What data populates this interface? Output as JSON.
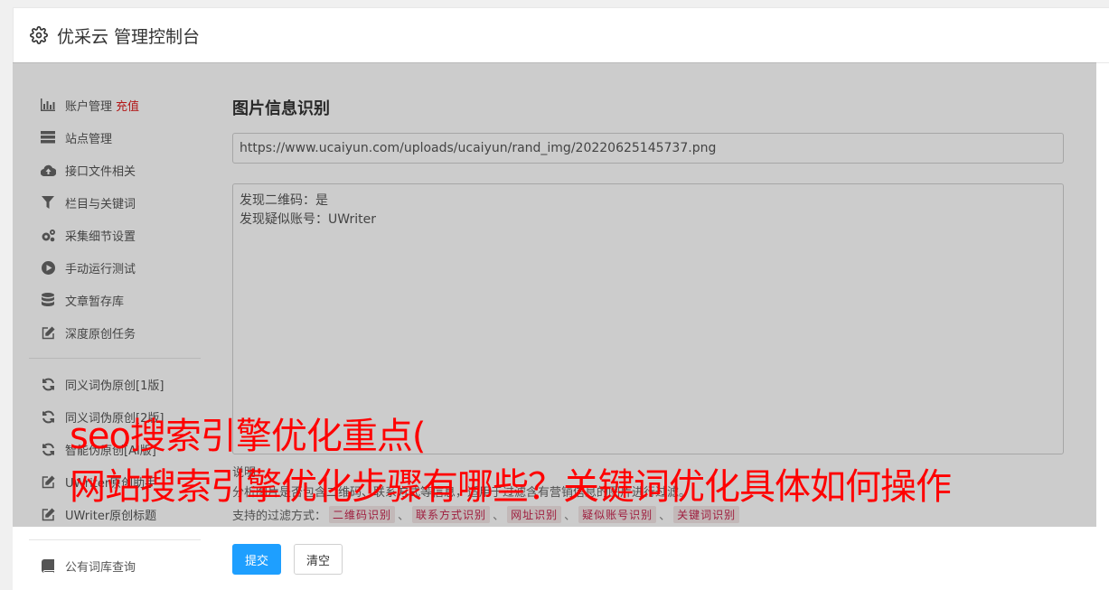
{
  "header": {
    "title": "优采云 管理控制台",
    "icon": "gear-icon"
  },
  "sidebar": {
    "items": [
      {
        "label": "账户管理",
        "extra": "充值",
        "icon": "bar-chart-icon"
      },
      {
        "label": "站点管理",
        "icon": "server-icon"
      },
      {
        "label": "接口文件相关",
        "icon": "cloud-upload-icon"
      },
      {
        "label": "栏目与关键词",
        "icon": "filter-icon"
      },
      {
        "label": "采集细节设置",
        "icon": "gears-icon"
      },
      {
        "label": "手动运行测试",
        "icon": "play-circle-icon"
      },
      {
        "label": "文章暂存库",
        "icon": "database-icon"
      },
      {
        "label": "深度原创任务",
        "icon": "edit-icon"
      }
    ],
    "items2": [
      {
        "label": "同义词伪原创[1版]",
        "icon": "refresh-icon"
      },
      {
        "label": "同义词伪原创[2版]",
        "icon": "refresh-icon"
      },
      {
        "label": "智能伪原创[AI版]",
        "icon": "refresh-icon"
      },
      {
        "label": "UWriter原创助手",
        "icon": "edit-icon"
      },
      {
        "label": "UWriter原创标题",
        "icon": "edit-icon"
      }
    ],
    "items3": [
      {
        "label": "公有词库查询",
        "icon": "book-icon"
      }
    ]
  },
  "main": {
    "title": "图片信息识别",
    "url_value": "https://www.ucaiyun.com/uploads/ucaiyun/rand_img/20220625145737.png",
    "result_lines": [
      "发现二维码：是",
      "发现疑似账号：UWriter"
    ],
    "note_title": "说明：",
    "note_text": "分析图片是否包含二维码、联系方式等信息，适用于过滤含有营销信息的图片进行过滤。",
    "filters_label": "支持的过滤方式：",
    "filters": [
      "二维码识别",
      "联系方式识别",
      "网址识别",
      "疑似账号识别",
      "关键词识别"
    ],
    "filter_sep": "、",
    "submit_label": "提交",
    "clear_label": "清空"
  },
  "overlay_text": {
    "line1": "seo搜索引擎优化重点(",
    "line2": "网站搜索引擎优化步骤有哪些？关键词优化具体如何操作"
  },
  "colors": {
    "accent": "#1e9fff",
    "danger": "#e02020",
    "overlay_text": "#ff0000"
  }
}
